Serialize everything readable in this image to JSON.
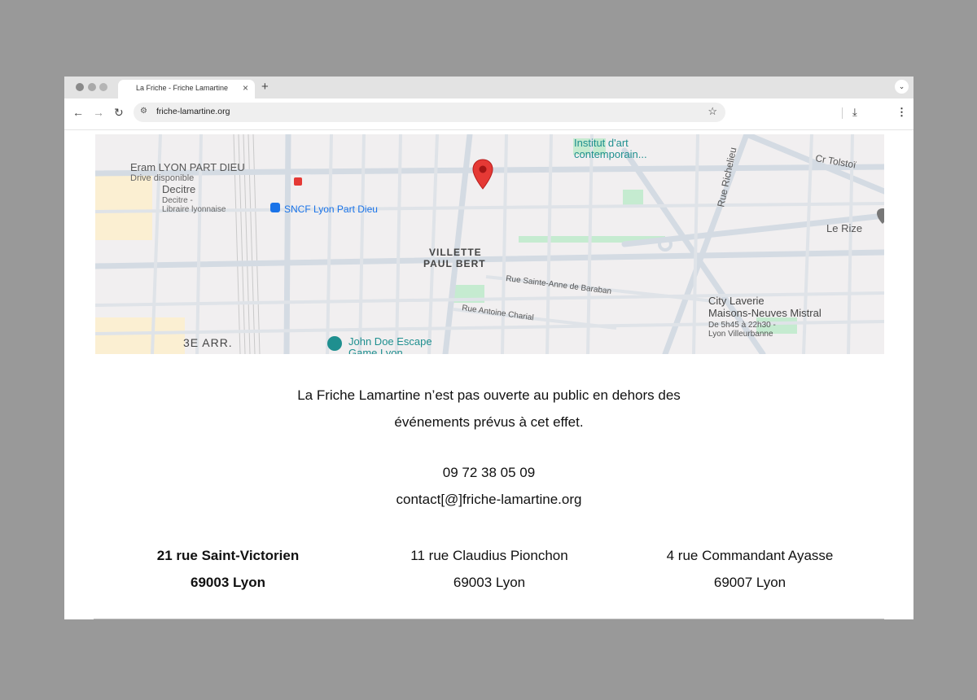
{
  "browser": {
    "tab_title": "La Friche - Friche Lamartine",
    "tab_close": "×",
    "new_tab": "+",
    "tab_menu": "⌄",
    "url": "friche-lamartine.org",
    "icons": [
      "back-arrow-icon",
      "forward-arrow-icon",
      "reload-icon",
      "site-settings-icon",
      "bookmark-star-icon",
      "download-icon",
      "kebab-menu-icon"
    ]
  },
  "map": {
    "labels": {
      "institut": "Institut d'art",
      "institut2": "contemporain...",
      "tolstoi": "Cr Tolstoï",
      "richelieu": "Rue Richelieu",
      "eram": "Eram LYON PART DIEU",
      "eram_sub": "Drive disponible",
      "decitre": "Decitre",
      "decitre_sub1": "Decitre -",
      "decitre_sub2": "Libraire lyonnaise",
      "sncf": "SNCF Lyon Part Dieu",
      "le_rize": "Le Rize",
      "villette": "VILLETTE",
      "paul_bert": "PAUL BERT",
      "baraban": "Rue Sainte-Anne de Baraban",
      "charial": "Rue Antoine Charial",
      "laverie1": "City Laverie",
      "laverie2": "Maisons-Neuves Mistral",
      "laverie3": "De 5h45 à 22h30 -",
      "laverie4": "Lyon Villeurbanne",
      "arr": "3E ARR.",
      "escape1": "John Doe Escape",
      "escape2": "Game Lyon"
    },
    "colors": {
      "background": "#f1eff0",
      "road": "#d4dbe3",
      "park": "#c5ebd0",
      "area": "#fbefd2",
      "pin": "#e53935",
      "poi_teal": "#1f8f8f",
      "transit_blue": "#1a73e8"
    }
  },
  "notice": {
    "line1": "La Friche Lamartine n’est pas ouverte au public en dehors des",
    "line2": "événements prévus à cet effet."
  },
  "contact": {
    "phone": "09 72 38 05 09",
    "email": "contact[@]friche-lamartine.org"
  },
  "addresses": [
    {
      "street": "21 rue Saint-Victorien",
      "city": "69003 Lyon"
    },
    {
      "street": "11 rue Claudius Pionchon",
      "city": "69003 Lyon"
    },
    {
      "street": "4 rue Commandant Ayasse",
      "city": "69007 Lyon"
    }
  ]
}
